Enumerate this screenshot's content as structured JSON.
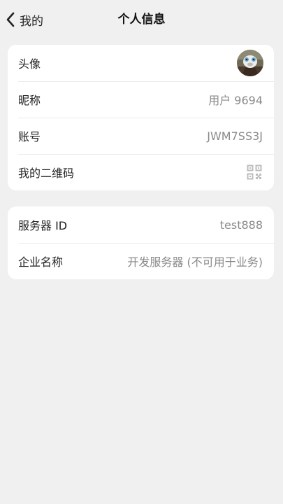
{
  "nav": {
    "back_label": "我的",
    "title": "个人信息"
  },
  "profile": {
    "avatar_label": "头像",
    "nickname_label": "昵称",
    "nickname_value": "用户 9694",
    "account_label": "账号",
    "account_value": "JWM7SS3J",
    "qrcode_label": "我的二维码"
  },
  "server": {
    "server_id_label": "服务器 ID",
    "server_id_value": "test888",
    "company_label": "企业名称",
    "company_value": "开发服务器 (不可用于业务)"
  },
  "icons": {
    "back": "chevron-left-icon",
    "qrcode": "qr-code-icon",
    "avatar": "avatar-image"
  },
  "colors": {
    "background": "#f0f0f0",
    "card": "#ffffff",
    "value_text": "#8a8a8a",
    "divider": "#ececec"
  }
}
